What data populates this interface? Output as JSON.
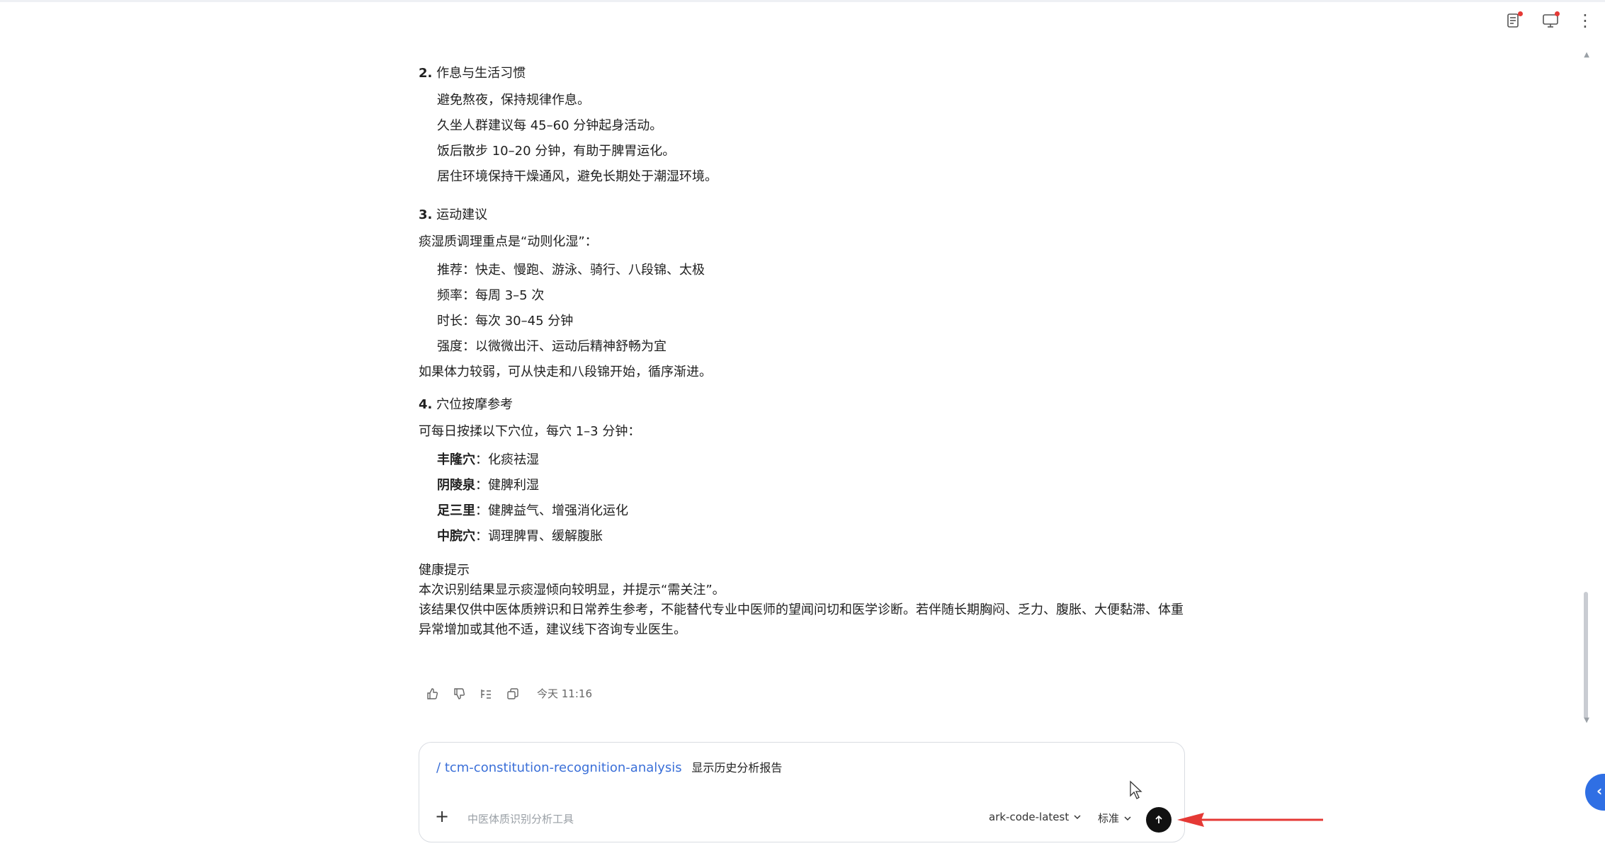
{
  "sections": {
    "s2": {
      "num": "2.",
      "title": "作息与生活习惯",
      "items": [
        "避免熬夜，保持规律作息。",
        "久坐人群建议每 45–60 分钟起身活动。",
        "饭后散步 10–20 分钟，有助于脾胃运化。",
        "居住环境保持干燥通风，避免长期处于潮湿环境。"
      ]
    },
    "s3": {
      "num": "3.",
      "title": "运动建议",
      "intro": "痰湿质调理重点是“动则化湿”：",
      "items": [
        "推荐：快走、慢跑、游泳、骑行、八段锦、太极",
        "频率：每周 3–5 次",
        "时长：每次 30–45 分钟",
        "强度：以微微出汗、运动后精神舒畅为宜"
      ],
      "outro": "如果体力较弱，可从快走和八段锦开始，循序渐进。"
    },
    "s4": {
      "num": "4.",
      "title": "穴位按摩参考",
      "intro": "可每日按揉以下穴位，每穴 1–3 分钟：",
      "points": [
        {
          "name": "丰隆穴",
          "desc": "：化痰祛湿"
        },
        {
          "name": "阴陵泉",
          "desc": "：健脾利湿"
        },
        {
          "name": "足三里",
          "desc": "：健脾益气、增强消化运化"
        },
        {
          "name": "中脘穴",
          "desc": "：调理脾胃、缓解腹胀"
        }
      ]
    },
    "health": {
      "title": "健康提示",
      "line1": "本次识别结果显示痰湿倾向较明显，并提示“需关注”。",
      "line2": "该结果仅供中医体质辨识和日常养生参考，不能替代专业中医师的望闻问切和医学诊断。若伴随长期胸闷、乏力、腹胀、大便黏滞、体重异常增加或其他不适，建议线下咨询专业医生。"
    }
  },
  "message_actions": {
    "time": "今天 11:16"
  },
  "input": {
    "slash": "/",
    "tool": "tcm-constitution-recognition-analysis",
    "command_desc": "显示历史分析报告",
    "placeholder": "中医体质识别分析工具",
    "model": "ark-code-latest",
    "mode": "标准"
  },
  "colors": {
    "link": "#3a6fd8",
    "send_button": "#111111",
    "side_button": "#2f6fe4",
    "annotation_arrow": "#e53935",
    "badge_dot": "#e53935"
  },
  "icons": [
    "task-list-icon",
    "monitor-icon",
    "more-vertical-icon",
    "thumbs-up-icon",
    "thumbs-down-icon",
    "branch-icon",
    "copy-icon",
    "plus-icon",
    "chevron-down-icon",
    "send-arrow-icon",
    "collapse-icon",
    "mouse-cursor-icon"
  ]
}
